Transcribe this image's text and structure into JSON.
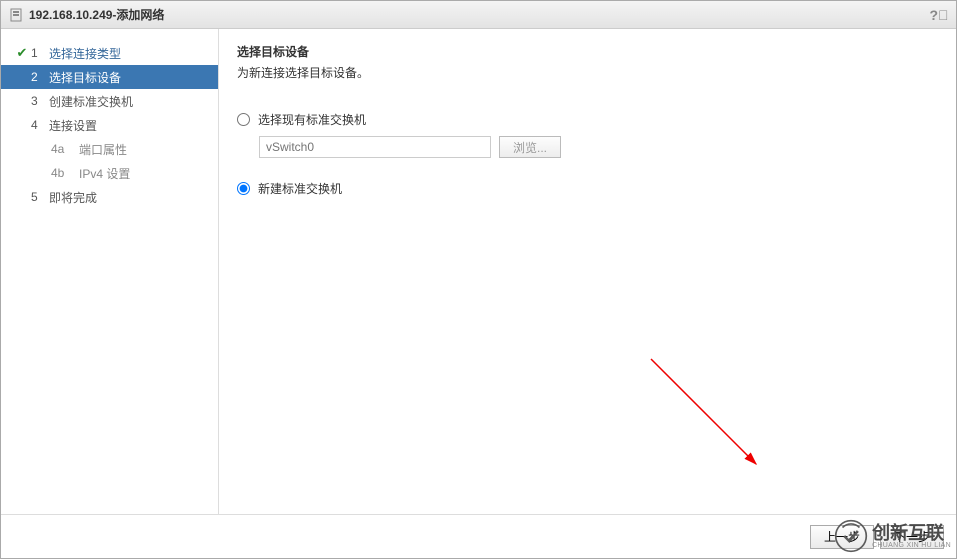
{
  "titlebar": {
    "host": "192.168.10.249",
    "separator": " - ",
    "title": "添加网络"
  },
  "sidebar": {
    "steps": [
      {
        "num": "1",
        "label": "选择连接类型",
        "completed": true
      },
      {
        "num": "2",
        "label": "选择目标设备",
        "selected": true
      },
      {
        "num": "3",
        "label": "创建标准交换机"
      },
      {
        "num": "4",
        "label": "连接设置"
      },
      {
        "num": "5",
        "label": "即将完成"
      }
    ],
    "substeps_of_4": [
      {
        "num": "4a",
        "label": "端口属性"
      },
      {
        "num": "4b",
        "label": "IPv4 设置"
      }
    ]
  },
  "main": {
    "heading": "选择目标设备",
    "subheading": "为新连接选择目标设备。",
    "option_existing": "选择现有标准交换机",
    "existing_value": "vSwitch0",
    "browse_label": "浏览...",
    "option_new": "新建标准交换机"
  },
  "footer": {
    "back": "上一步",
    "next": "下一步"
  },
  "watermark": {
    "text": "创新互联",
    "sub": "CHUANG XIN HU LIAN"
  }
}
